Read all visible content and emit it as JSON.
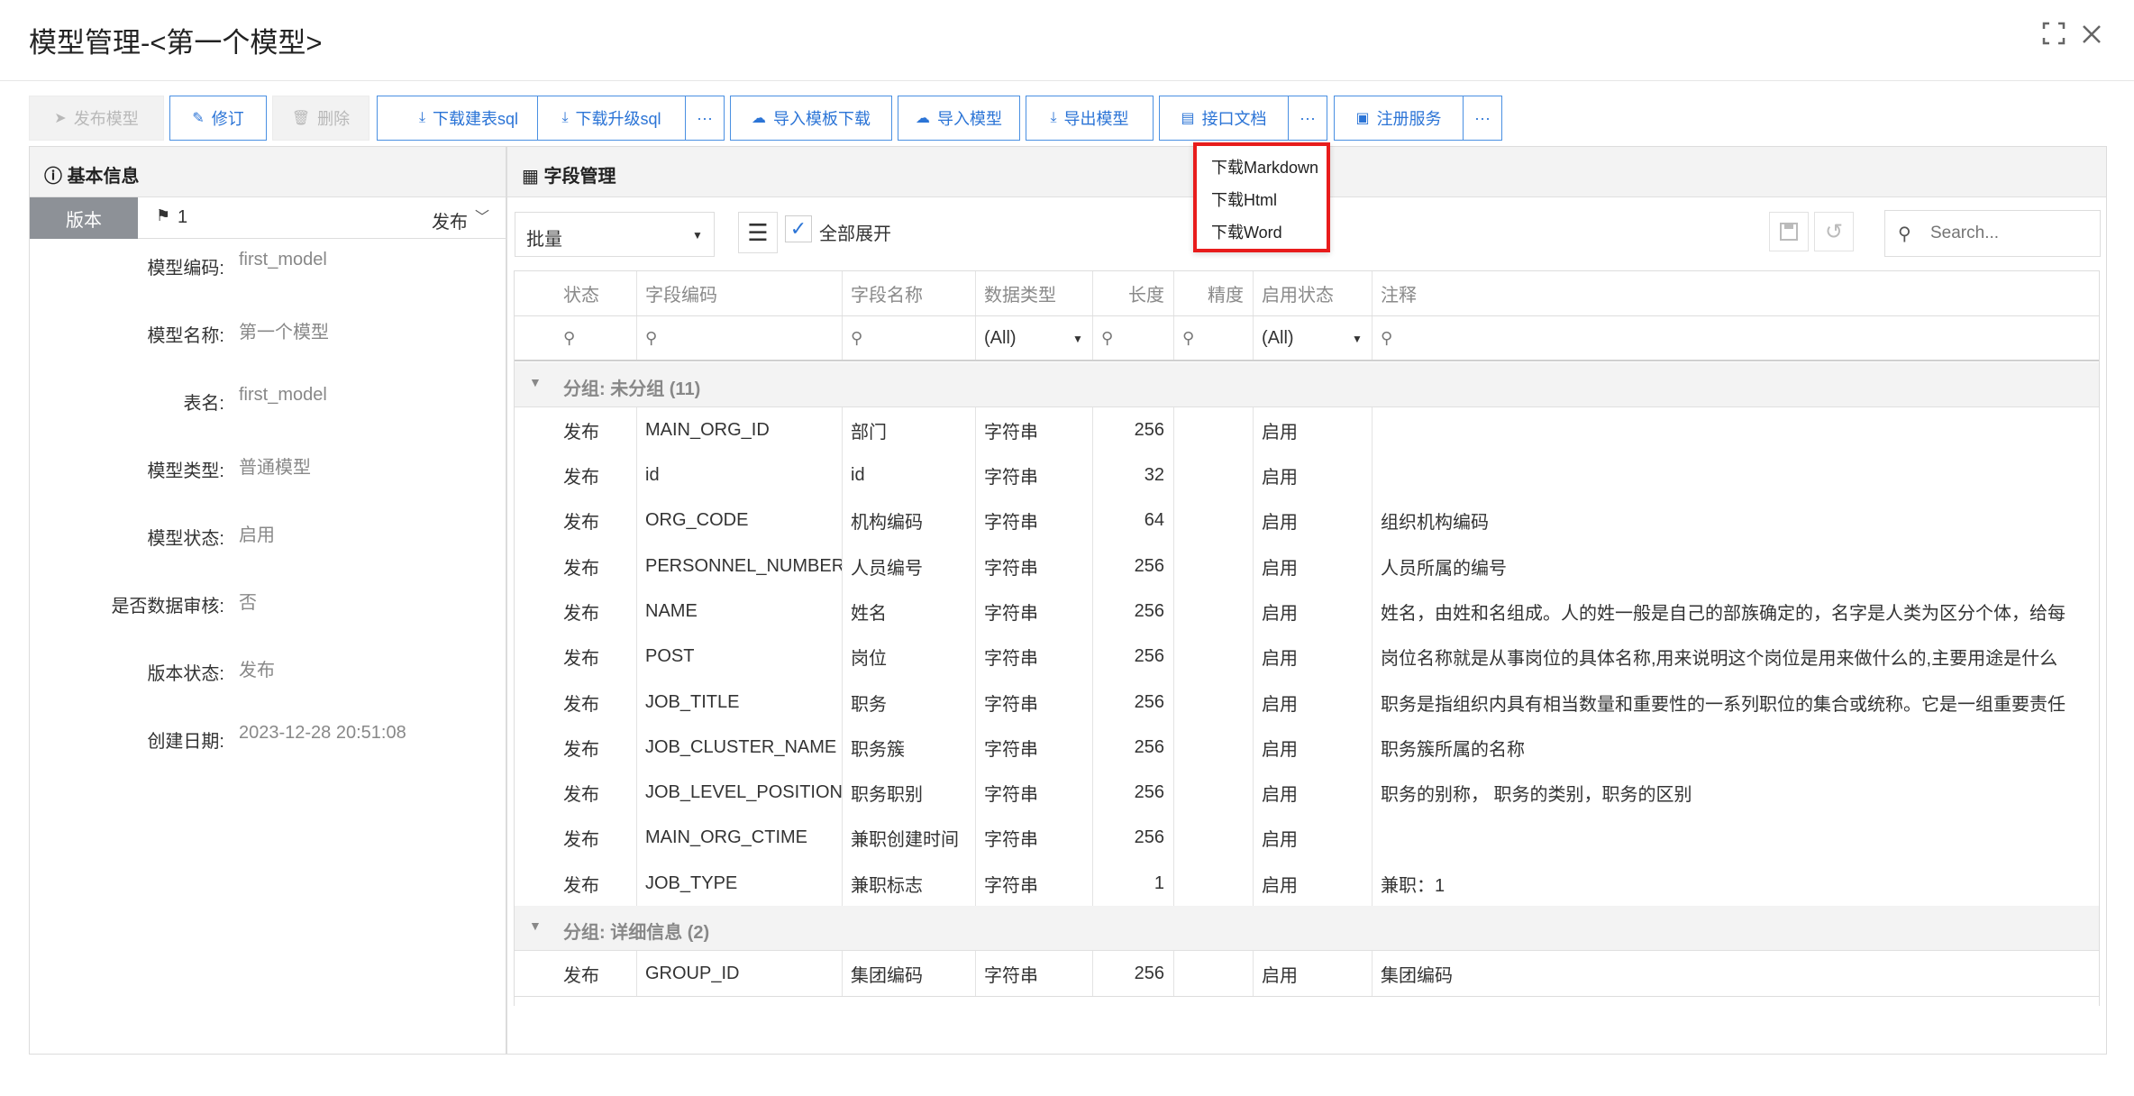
{
  "window": {
    "title": "模型管理-<第一个模型>",
    "maximize_icon": "maximize-icon",
    "close_icon": "close-icon"
  },
  "toolbar": {
    "publish": "发布模型",
    "revise": "修订",
    "delete": "删除",
    "download_create_sql": "下载建表sql",
    "download_upgrade_sql": "下载升级sql",
    "more": "···",
    "import_template_download": "导入模板下载",
    "import_model": "导入模型",
    "export_model": "导出模型",
    "api_docs": "接口文档",
    "register_service": "注册服务"
  },
  "api_docs_menu": [
    "下载Markdown",
    "下载Html",
    "下载Word"
  ],
  "left_panel": {
    "title": "基本信息",
    "version_tab": "版本",
    "version_number": "1",
    "version_status_select": "发布",
    "fields": [
      {
        "label": "模型编码:",
        "value": "first_model"
      },
      {
        "label": "模型名称:",
        "value": "第一个模型"
      },
      {
        "label": "表名:",
        "value": "first_model"
      },
      {
        "label": "模型类型:",
        "value": "普通模型"
      },
      {
        "label": "模型状态:",
        "value": "启用"
      },
      {
        "label": "是否数据审核:",
        "value": "否"
      },
      {
        "label": "版本状态:",
        "value": "发布"
      },
      {
        "label": "创建日期:",
        "value": "2023-12-28 20:51:08"
      }
    ]
  },
  "right_panel": {
    "title": "字段管理",
    "batch_select": "批量",
    "expand_all": "全部展开",
    "search_placeholder": "Search..."
  },
  "grid": {
    "columns": [
      "状态",
      "字段编码",
      "字段名称",
      "数据类型",
      "长度",
      "精度",
      "启用状态",
      "注释"
    ],
    "filter_all": "(All)",
    "groups": [
      {
        "label": "分组: 未分组 (11)",
        "rows": [
          [
            "发布",
            "MAIN_ORG_ID",
            "部门",
            "字符串",
            "256",
            "",
            "启用",
            ""
          ],
          [
            "发布",
            "id",
            "id",
            "字符串",
            "32",
            "",
            "启用",
            ""
          ],
          [
            "发布",
            "ORG_CODE",
            "机构编码",
            "字符串",
            "64",
            "",
            "启用",
            "组织机构编码"
          ],
          [
            "发布",
            "PERSONNEL_NUMBER",
            "人员编号",
            "字符串",
            "256",
            "",
            "启用",
            "人员所属的编号"
          ],
          [
            "发布",
            "NAME",
            "姓名",
            "字符串",
            "256",
            "",
            "启用",
            "姓名，由姓和名组成。人的姓一般是自己的部族确定的，名字是人类为区分个体，给每"
          ],
          [
            "发布",
            "POST",
            "岗位",
            "字符串",
            "256",
            "",
            "启用",
            "岗位名称就是从事岗位的具体名称,用来说明这个岗位是用来做什么的,主要用途是什么"
          ],
          [
            "发布",
            "JOB_TITLE",
            "职务",
            "字符串",
            "256",
            "",
            "启用",
            "职务是指组织内具有相当数量和重要性的一系列职位的集合或统称。它是一组重要责任"
          ],
          [
            "发布",
            "JOB_CLUSTER_NAME",
            "职务簇",
            "字符串",
            "256",
            "",
            "启用",
            "职务簇所属的名称"
          ],
          [
            "发布",
            "JOB_LEVEL_POSITION",
            "职务职别",
            "字符串",
            "256",
            "",
            "启用",
            "职务的别称， 职务的类别，职务的区别"
          ],
          [
            "发布",
            "MAIN_ORG_CTIME",
            "兼职创建时间",
            "字符串",
            "256",
            "",
            "启用",
            ""
          ],
          [
            "发布",
            "JOB_TYPE",
            "兼职标志",
            "字符串",
            "1",
            "",
            "启用",
            "兼职：1"
          ]
        ]
      },
      {
        "label": "分组: 详细信息 (2)",
        "rows": [
          [
            "发布",
            "GROUP_ID",
            "集团编码",
            "字符串",
            "256",
            "",
            "启用",
            "集团编码"
          ]
        ]
      }
    ]
  }
}
